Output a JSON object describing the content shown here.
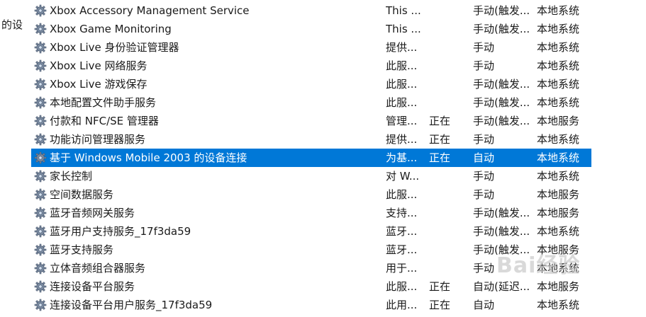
{
  "side_text": "的设",
  "icon": "gear-service-icon",
  "selected_color": "#0078d7",
  "services": [
    {
      "name": "Xbox Accessory Management Service",
      "desc": "This ...",
      "status": "",
      "startup": "手动(触发...",
      "logon": "本地系统"
    },
    {
      "name": "Xbox Game Monitoring",
      "desc": "This ...",
      "status": "",
      "startup": "手动(触发...",
      "logon": "本地系统"
    },
    {
      "name": "Xbox Live 身份验证管理器",
      "desc": "提供...",
      "status": "",
      "startup": "手动",
      "logon": "本地系统"
    },
    {
      "name": "Xbox Live 网络服务",
      "desc": "此服...",
      "status": "",
      "startup": "手动",
      "logon": "本地系统"
    },
    {
      "name": "Xbox Live 游戏保存",
      "desc": "此服...",
      "status": "",
      "startup": "手动(触发...",
      "logon": "本地系统"
    },
    {
      "name": "本地配置文件助手服务",
      "desc": "此服...",
      "status": "",
      "startup": "手动(触发...",
      "logon": "本地系统"
    },
    {
      "name": "付款和 NFC/SE 管理器",
      "desc": "管理...",
      "status": "正在",
      "startup": "手动(触发...",
      "logon": "本地服务"
    },
    {
      "name": "功能访问管理器服务",
      "desc": "提供...",
      "status": "正在",
      "startup": "手动",
      "logon": "本地系统"
    },
    {
      "name": "基于 Windows Mobile 2003 的设备连接",
      "desc": "为基...",
      "status": "正在",
      "startup": "自动",
      "logon": "本地系统",
      "selected": true
    },
    {
      "name": "家长控制",
      "desc": "对 W...",
      "status": "",
      "startup": "手动",
      "logon": "本地系统"
    },
    {
      "name": "空间数据服务",
      "desc": "此服...",
      "status": "",
      "startup": "手动",
      "logon": "本地服务"
    },
    {
      "name": "蓝牙音频网关服务",
      "desc": "支持...",
      "status": "",
      "startup": "手动(触发...",
      "logon": "本地服务"
    },
    {
      "name": "蓝牙用户支持服务_17f3da59",
      "desc": "蓝牙...",
      "status": "",
      "startup": "手动(触发...",
      "logon": "本地系统"
    },
    {
      "name": "蓝牙支持服务",
      "desc": "蓝牙...",
      "status": "",
      "startup": "手动(触发...",
      "logon": "本地服务"
    },
    {
      "name": "立体音频组合器服务",
      "desc": "用于...",
      "status": "",
      "startup": "手动",
      "logon": "本地系统"
    },
    {
      "name": "连接设备平台服务",
      "desc": "此服...",
      "status": "正在",
      "startup": "自动(延迟...",
      "logon": "本地服务"
    },
    {
      "name": "连接设备平台用户服务_17f3da59",
      "desc": "此用...",
      "status": "正在",
      "startup": "自动",
      "logon": "本地系统"
    }
  ],
  "watermark": "Bai经验"
}
